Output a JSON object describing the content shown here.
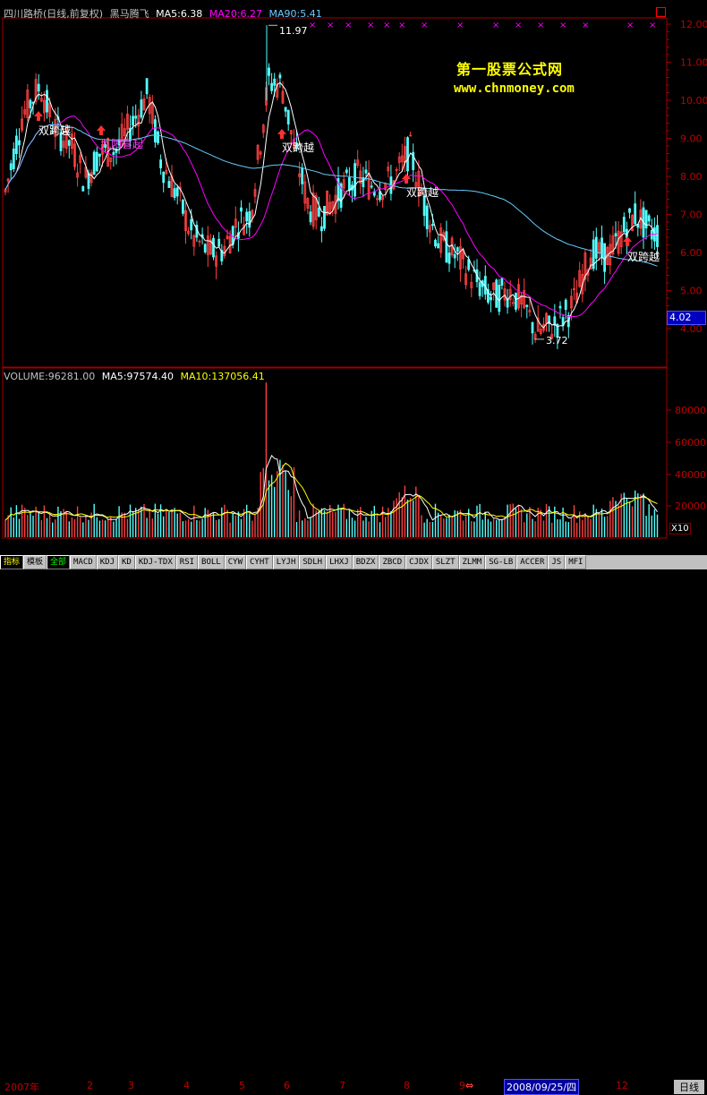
{
  "header": {
    "title": "四川路桥(日线,前复权)",
    "indicator": "黑马腾飞",
    "ma5": "MA5:6.38",
    "ma20": "MA20:6.27",
    "ma90": "MA90:5.41"
  },
  "volume_header": {
    "volume": "VOLUME:96281.00",
    "ma5": "MA5:97574.40",
    "ma10": "MA10:137056.41"
  },
  "watermark": {
    "line1": "第一股票公式网",
    "line2": "www.chnmoney.com"
  },
  "price_axis": [
    "12.00",
    "11.00",
    "10.00",
    "9.00",
    "8.00",
    "7.00",
    "6.00",
    "5.00",
    "4.00"
  ],
  "volume_axis": [
    "80000",
    "60000",
    "40000",
    "20000"
  ],
  "current_price": "4.02",
  "annotations": {
    "high": "11.97",
    "low": "3.72",
    "cross1": "双跨越",
    "rise": "九阳喜起",
    "cross2": "双跨越",
    "cross3": "双跨越",
    "cross4": "双跨越"
  },
  "x10_label": "X10",
  "date_axis": {
    "labels": [
      "2007年",
      "2",
      "3",
      "4",
      "5",
      "6",
      "7",
      "8",
      "9",
      "12"
    ],
    "highlight": "2008/09/25/四",
    "period": "日线"
  },
  "tabs": [
    "指标",
    "模板",
    "全部",
    "MACD",
    "KDJ",
    "KD",
    "KDJ-TDX",
    "RSI",
    "BOLL",
    "CYW",
    "CYHT",
    "LYJH",
    "SDLH",
    "LHXJ",
    "BDZX",
    "ZBCD",
    "CJDX",
    "SLZT",
    "ZLMM",
    "SG-LB",
    "ACCER",
    "JS",
    "MFI"
  ],
  "colors": {
    "up": "#ff4040",
    "down": "#54ffff",
    "ma5": "#ffffff",
    "ma20": "#ff00ff",
    "ma90": "#66ccff",
    "vol_ma5": "#ffffff",
    "vol_ma10": "#ffff00"
  }
}
